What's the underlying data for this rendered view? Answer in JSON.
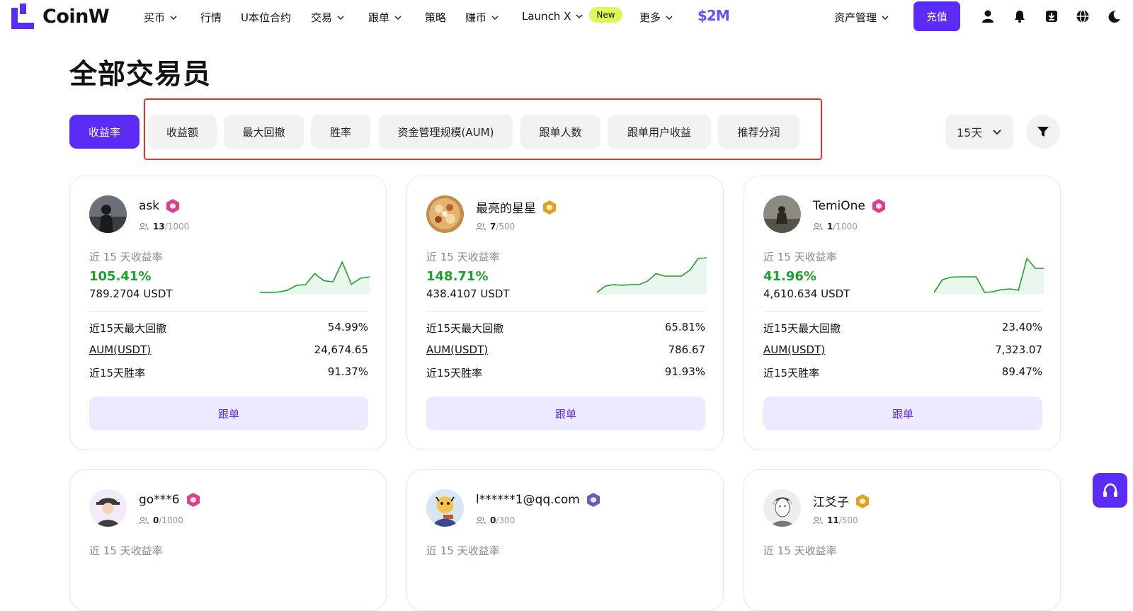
{
  "brand": {
    "name": "CoinW",
    "accent": "#5b2cf5",
    "promo": "$2M"
  },
  "nav": {
    "items": [
      {
        "label": "买币",
        "dropdown": true
      },
      {
        "label": "行情",
        "dropdown": false
      },
      {
        "label": "U本位合约",
        "dropdown": false
      },
      {
        "label": "交易",
        "dropdown": true
      },
      {
        "label": "跟单",
        "dropdown": true
      },
      {
        "label": "策略",
        "dropdown": false
      },
      {
        "label": "赚币",
        "dropdown": true
      },
      {
        "label": "Launch X",
        "dropdown": true,
        "badge": "New"
      },
      {
        "label": "更多",
        "dropdown": true
      }
    ],
    "asset_management": "资产管理",
    "deposit": "充值",
    "icons": [
      "user-icon",
      "bell-icon",
      "download-icon",
      "globe-icon",
      "moon-icon"
    ]
  },
  "page": {
    "title": "全部交易员"
  },
  "sort_tabs": [
    "收益率",
    "收益额",
    "最大回撤",
    "胜率",
    "资金管理规模(AUM)",
    "跟单人数",
    "跟单用户收益",
    "推荐分润"
  ],
  "active_tab": 0,
  "period_select": "15天",
  "card_labels": {
    "period_roi": "近 15 天收益率",
    "max_drawdown": "近15天最大回撤",
    "aum": "AUM(USDT)",
    "win_rate": "近15天胜率",
    "follow": "跟单"
  },
  "traders": [
    {
      "name": "ask",
      "followers": "13",
      "capacity": "/1000",
      "roi": "105.41%",
      "profit": "789.2704 USDT",
      "max_drawdown": "54.99%",
      "aum": "24,674.65",
      "win_rate": "91.37%",
      "badge_color": "#e0408a",
      "spark": [
        0.02,
        0.02,
        0.03,
        0.08,
        0.22,
        0.24,
        0.55,
        0.35,
        0.32,
        0.88,
        0.25,
        0.42,
        0.46
      ],
      "spark_color": "#1e9e2f"
    },
    {
      "name": "最亮的星星",
      "followers": "7",
      "capacity": "/500",
      "roi": "148.71%",
      "profit": "438.4107 USDT",
      "max_drawdown": "65.81%",
      "aum": "786.67",
      "win_rate": "91.93%",
      "badge_color": "#e3a21a",
      "spark": [
        0.02,
        0.2,
        0.24,
        0.22,
        0.24,
        0.24,
        0.34,
        0.55,
        0.48,
        0.48,
        0.48,
        0.65,
        0.98,
        1.0
      ],
      "spark_color": "#1e9e2f"
    },
    {
      "name": "TemiOne",
      "followers": "1",
      "capacity": "/1000",
      "roi": "41.96%",
      "profit": "4,610.634 USDT",
      "max_drawdown": "23.40%",
      "aum": "7,323.07",
      "win_rate": "89.47%",
      "badge_color": "#e0408a",
      "spark": [
        0.02,
        0.38,
        0.45,
        0.46,
        0.46,
        0.46,
        0.02,
        0.04,
        0.1,
        0.12,
        0.08,
        0.98,
        0.7,
        0.7
      ],
      "spark_color": "#1e9e2f"
    },
    {
      "name": "go***6",
      "followers": "0",
      "capacity": "/1000",
      "badge_color": "#e0408a"
    },
    {
      "name": "l******1@qq.com",
      "followers": "0",
      "capacity": "/300",
      "badge_color": "#6b5bb5"
    },
    {
      "name": "江爻子",
      "followers": "11",
      "capacity": "/500",
      "badge_color": "#e3a21a"
    }
  ]
}
